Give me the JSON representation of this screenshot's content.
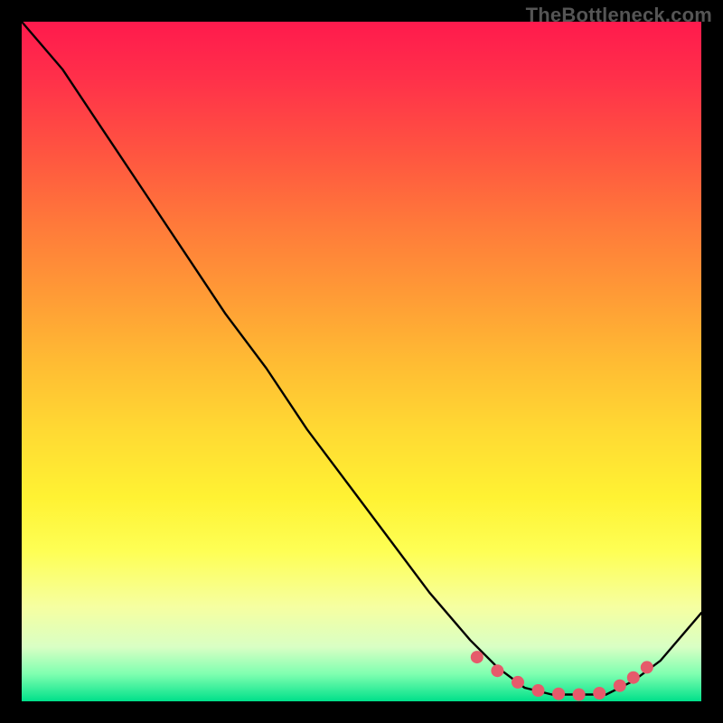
{
  "watermark": "TheBottleneck.com",
  "colors": {
    "marker": "#e65a6b",
    "curve": "#000000"
  },
  "chart_data": {
    "type": "line",
    "title": "",
    "xlabel": "",
    "ylabel": "",
    "xlim": [
      0,
      100
    ],
    "ylim": [
      0,
      100
    ],
    "grid": false,
    "series": [
      {
        "name": "bottleneck-curve",
        "x": [
          0,
          6,
          12,
          18,
          24,
          30,
          36,
          42,
          48,
          54,
          60,
          66,
          70,
          74,
          78,
          82,
          86,
          90,
          94,
          100
        ],
        "y": [
          100,
          93,
          84,
          75,
          66,
          57,
          49,
          40,
          32,
          24,
          16,
          9,
          5,
          2,
          1,
          1,
          1,
          3,
          6,
          13
        ]
      }
    ],
    "markers": {
      "name": "optimal-zone",
      "x": [
        67,
        70,
        73,
        76,
        79,
        82,
        85,
        88,
        90,
        92
      ],
      "y": [
        6.5,
        4.5,
        2.8,
        1.6,
        1.1,
        1.0,
        1.2,
        2.3,
        3.5,
        5.0
      ]
    }
  }
}
